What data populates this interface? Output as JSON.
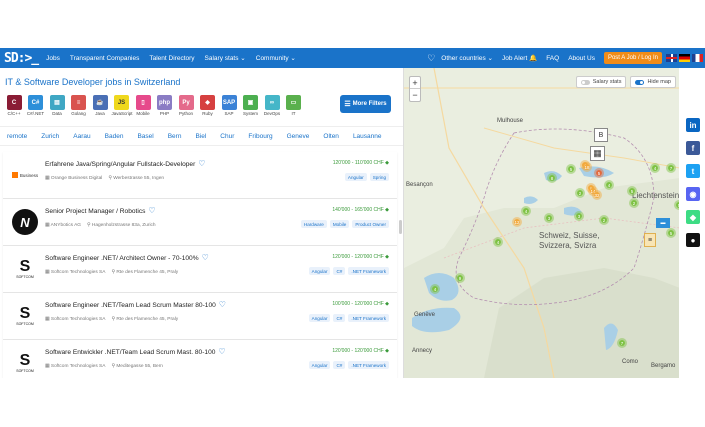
{
  "nav": {
    "logo": "SD:>_",
    "items": [
      "Jobs",
      "Transparent Companies",
      "Talent Directory",
      "Salary stats ⌄",
      "Community ⌄"
    ],
    "right_items": [
      "Other countries ⌄",
      "Job Alert 🔔",
      "FAQ",
      "About Us"
    ],
    "post_job": "Post A Job / Log In",
    "brand_color": "#1a73c9",
    "accent_color": "#f08c18"
  },
  "page": {
    "title": "IT & Software Developer jobs in Switzerland",
    "more_filters": "More Filters"
  },
  "tech_filters": [
    {
      "label": "C/C++",
      "icon": "cpp-icon",
      "color": "#8a1c35",
      "glyph": "C"
    },
    {
      "label": "C#/.NET",
      "icon": "csharp-icon",
      "color": "#2d8fd9",
      "glyph": "C#"
    },
    {
      "label": "Data",
      "icon": "data-icon",
      "color": "#3fa7c4",
      "glyph": "▤"
    },
    {
      "label": "Golang",
      "icon": "golang-icon",
      "color": "#d9534f",
      "glyph": "≡"
    },
    {
      "label": "Java",
      "icon": "java-icon",
      "color": "#4a6fb5",
      "glyph": "☕"
    },
    {
      "label": "JavaScript",
      "icon": "javascript-icon",
      "color": "#efd81d",
      "glyph": "JS"
    },
    {
      "label": "Mobile",
      "icon": "mobile-icon",
      "color": "#e64a8b",
      "glyph": "▯"
    },
    {
      "label": "PHP",
      "icon": "php-icon",
      "color": "#8a7cc4",
      "glyph": "php"
    },
    {
      "label": "Python",
      "icon": "python-icon",
      "color": "#e46a8b",
      "glyph": "Py"
    },
    {
      "label": "Ruby",
      "icon": "ruby-icon",
      "color": "#d64040",
      "glyph": "◆"
    },
    {
      "label": "SAP",
      "icon": "sap-icon",
      "color": "#3b82d6",
      "glyph": "SAP"
    },
    {
      "label": "System",
      "icon": "system-icon",
      "color": "#4caf50",
      "glyph": "▣"
    },
    {
      "label": "DevOps",
      "icon": "devops-icon",
      "color": "#45b6c8",
      "glyph": "∞"
    },
    {
      "label": "IT",
      "icon": "it-icon",
      "color": "#5ab04d",
      "glyph": "▭"
    }
  ],
  "cities": [
    "remote",
    "Zurich",
    "Aarau",
    "Baden",
    "Basel",
    "Bern",
    "Biel",
    "Chur",
    "Fribourg",
    "Geneve",
    "Olten",
    "Lausanne"
  ],
  "jobs": [
    {
      "title": "Erfahrene Java/Spring/Angular Fullstack-Developer",
      "company": "Orange Business Digital",
      "address": "Werbestrasse 55, Ingen",
      "salary": "120'000 - 110'000 CHF",
      "tags": [
        "Angular",
        "Spring"
      ],
      "logo": "orange-business-logo"
    },
    {
      "title": "Senior Project Manager / Robotics",
      "company": "ANYbotics AG",
      "address": "Hagenholzstrasse 83a, Zurich",
      "salary": "140'000 - 165'000 CHF",
      "tags": [
        "Hardware",
        "Mobile",
        "Product Owner"
      ],
      "logo": "anybotics-logo"
    },
    {
      "title": "Software Engineer .NET/ Architect Owner - 70-100%",
      "company": "Softcom Technologies SA",
      "address": "Rte des Flamenche 45, Praly",
      "salary": "120'000 - 120'000 CHF",
      "tags": [
        "Angular",
        "C#",
        ".NET Framework"
      ],
      "logo": "softcom-logo"
    },
    {
      "title": "Software Engineer .NET/Team Lead Scrum Master 80-100",
      "company": "Softcom Technologies SA",
      "address": "Rte des Flamenche 45, Praly",
      "salary": "100'000 - 120'000 CHF",
      "tags": [
        "Angular",
        "C#",
        ".NET Framework"
      ],
      "logo": "softcom-logo"
    },
    {
      "title": "Software Entwickler .NET/Team Lead Scrum Mast. 80-100",
      "company": "Softcom Technologies SA",
      "address": "Meditegasse 55, Bern",
      "salary": "120'000 - 120'000 CHF",
      "tags": [
        "Angular",
        "C#",
        ".NET Framework"
      ],
      "logo": "softcom-logo"
    }
  ],
  "map": {
    "zoom_in": "+",
    "zoom_out": "−",
    "salary_stats": "Salary stats",
    "hide_map": "Hide map",
    "labels": {
      "mulhouse": "Mulhouse",
      "besancon": "Besançon",
      "schweiz": "Schweiz, Suisse,",
      "svizzera": "Svizzera, Svizra",
      "liechtenstein": "Liechtenstein",
      "geneve": "Genève",
      "annecy": "Annecy",
      "como": "Como",
      "bergamo": "Bergamo"
    },
    "clusters": [
      "8",
      "5",
      "4",
      "5",
      "6",
      "2",
      "18",
      "14",
      "4",
      "5",
      "32",
      "4",
      "7",
      "12",
      "4",
      "4",
      "3",
      "2",
      "5",
      "9",
      "4",
      "7",
      "3",
      "2",
      "5"
    ]
  },
  "social": [
    {
      "icon": "linkedin-icon",
      "glyph": "in",
      "color": "#0a66c2"
    },
    {
      "icon": "facebook-icon",
      "glyph": "f",
      "color": "#3b5998"
    },
    {
      "icon": "twitter-icon",
      "glyph": "t",
      "color": "#1da1f2"
    },
    {
      "icon": "discord-icon",
      "glyph": "◉",
      "color": "#5865f2"
    },
    {
      "icon": "android-icon",
      "glyph": "◆",
      "color": "#3ddc84"
    },
    {
      "icon": "apple-icon",
      "glyph": "●",
      "color": "#111111"
    }
  ]
}
